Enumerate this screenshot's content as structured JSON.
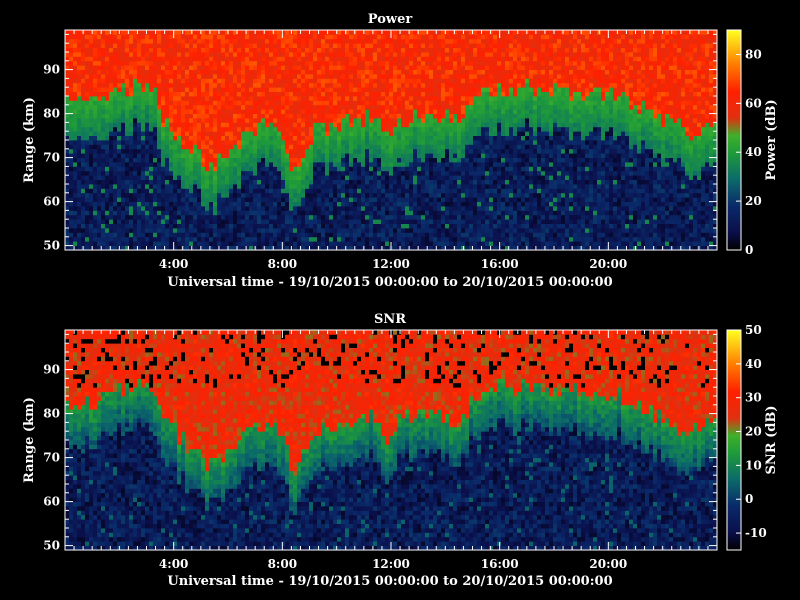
{
  "chart_data": [
    {
      "type": "heatmap",
      "title": "Power",
      "xlabel": "Universal time - 19/10/2015 00:00:00 to 20/10/2015 00:00:00",
      "ylabel": "Range (km)",
      "xticks": [
        "4:00",
        "8:00",
        "12:00",
        "16:00",
        "20:00"
      ],
      "xtick_hours": [
        4,
        8,
        12,
        16,
        20
      ],
      "xlim_hours": [
        0,
        24
      ],
      "yticks": [
        50,
        60,
        70,
        80,
        90
      ],
      "ylim": [
        49,
        99
      ],
      "colorbar": {
        "label": "Power (dB)",
        "ticks": [
          0,
          20,
          40,
          60,
          80
        ],
        "range": [
          0,
          90
        ]
      },
      "signal_top_km": [
        [
          0.0,
          80
        ],
        [
          1.0,
          79
        ],
        [
          2.0,
          82
        ],
        [
          3.2,
          84
        ],
        [
          3.6,
          76
        ],
        [
          4.5,
          70
        ],
        [
          5.4,
          65
        ],
        [
          6.2,
          69
        ],
        [
          7.0,
          74
        ],
        [
          7.7,
          76
        ],
        [
          8.4,
          64
        ],
        [
          9.2,
          73
        ],
        [
          10.5,
          75
        ],
        [
          11.5,
          77
        ],
        [
          11.8,
          70
        ],
        [
          12.2,
          76
        ],
        [
          13.5,
          77
        ],
        [
          14.6,
          75
        ],
        [
          15.2,
          82
        ],
        [
          16.2,
          83
        ],
        [
          19.0,
          82
        ],
        [
          20.5,
          81
        ],
        [
          21.5,
          78
        ],
        [
          22.5,
          74
        ],
        [
          23.3,
          73
        ],
        [
          24.0,
          76
        ]
      ],
      "mid_level_db": 40,
      "upper_level_db": 60,
      "lower_level_db": 10
    },
    {
      "type": "heatmap",
      "title": "SNR",
      "xlabel": "Universal time - 19/10/2015 00:00:00 to 20/10/2015 00:00:00",
      "ylabel": "Range (km)",
      "xticks": [
        "4:00",
        "8:00",
        "12:00",
        "16:00",
        "20:00"
      ],
      "xtick_hours": [
        4,
        8,
        12,
        16,
        20
      ],
      "xlim_hours": [
        0,
        24
      ],
      "yticks": [
        50,
        60,
        70,
        80,
        90
      ],
      "ylim": [
        49,
        99
      ],
      "colorbar": {
        "label": "SNR (dB)",
        "ticks": [
          -10,
          0,
          10,
          20,
          30,
          40,
          50
        ],
        "range": [
          -15,
          50
        ]
      },
      "signal_top_km": [
        [
          0.0,
          80
        ],
        [
          1.0,
          79
        ],
        [
          2.0,
          82
        ],
        [
          3.2,
          84
        ],
        [
          3.6,
          76
        ],
        [
          4.5,
          70
        ],
        [
          5.4,
          65
        ],
        [
          6.2,
          69
        ],
        [
          7.0,
          74
        ],
        [
          7.7,
          76
        ],
        [
          8.4,
          64
        ],
        [
          9.2,
          73
        ],
        [
          10.5,
          75
        ],
        [
          11.5,
          77
        ],
        [
          11.8,
          70
        ],
        [
          12.2,
          76
        ],
        [
          13.5,
          77
        ],
        [
          14.6,
          75
        ],
        [
          15.2,
          82
        ],
        [
          16.2,
          83
        ],
        [
          19.0,
          82
        ],
        [
          20.5,
          81
        ],
        [
          21.5,
          78
        ],
        [
          22.5,
          74
        ],
        [
          23.3,
          73
        ],
        [
          24.0,
          76
        ]
      ],
      "mid_level_db": 10,
      "upper_level_db": 25,
      "lower_level_db": -8
    }
  ]
}
